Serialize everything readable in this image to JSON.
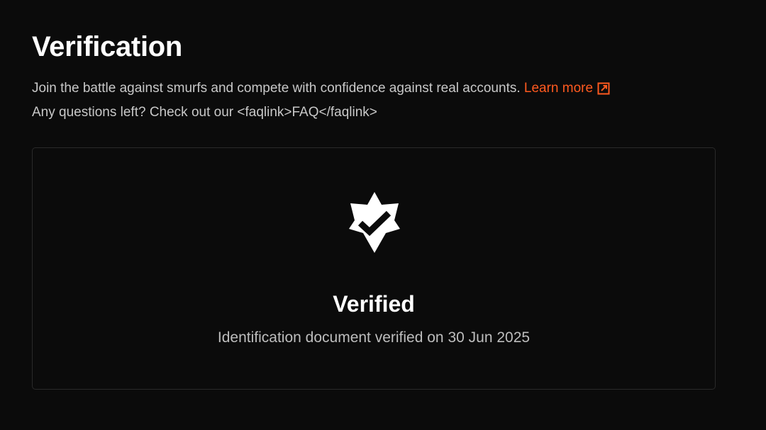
{
  "header": {
    "title": "Verification"
  },
  "description": {
    "line1": "Join the battle against smurfs and compete with confidence against real accounts.",
    "learn_more_label": "Learn more",
    "learn_more_icon": "external-link-icon",
    "line2": "Any questions left? Check out our <faqlink>FAQ</faqlink>"
  },
  "status_card": {
    "icon": "verified-badge-icon",
    "title": "Verified",
    "subtitle": "Identification document verified on 30 Jun 2025"
  },
  "colors": {
    "background": "#0b0b0b",
    "accent": "#ff5a1f",
    "card_border": "#2a2a2a",
    "text_primary": "#ffffff",
    "text_secondary": "#c8c8c8"
  }
}
